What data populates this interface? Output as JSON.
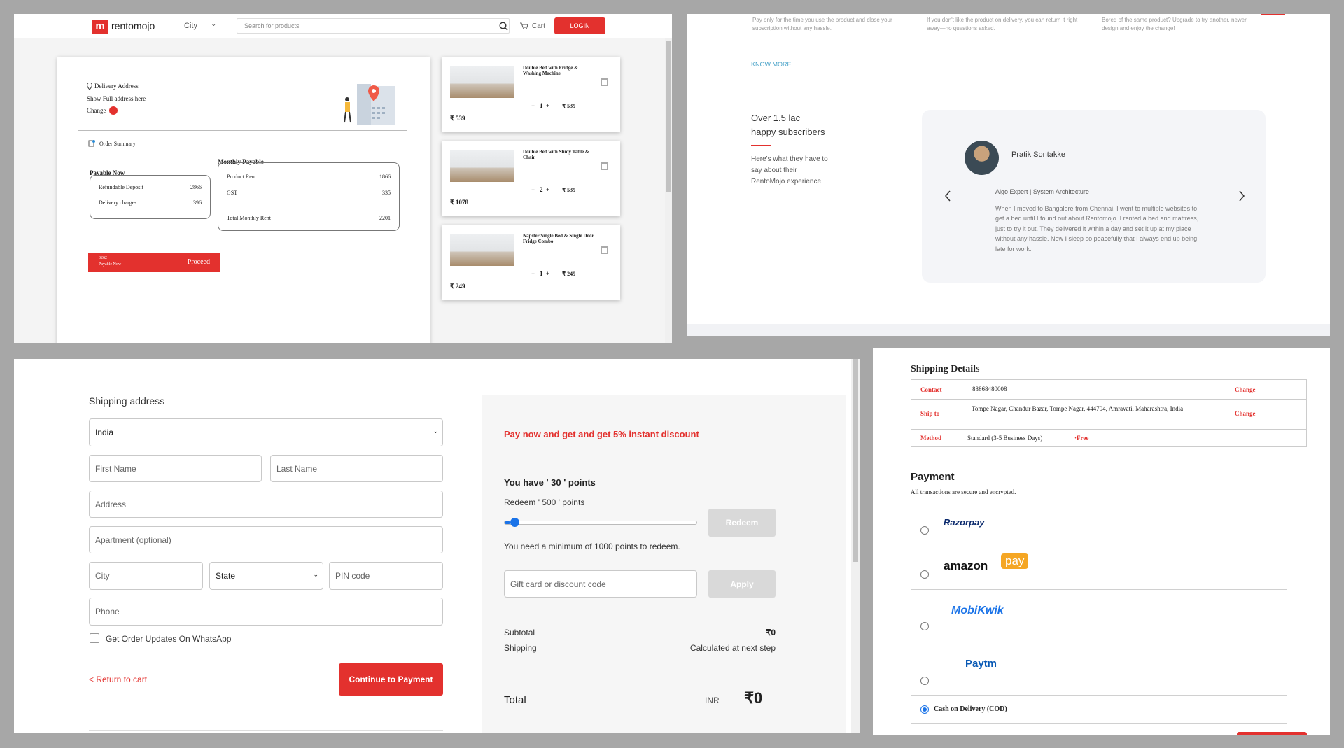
{
  "cart_page": {
    "brand": "rentomojo",
    "city_label": "City",
    "search_placeholder": "Search for products",
    "cart_label": "Cart",
    "login_label": "LOGIN",
    "delivery_title": "Delivery Address",
    "address_hint": "Show Full address here",
    "change_label": "Change",
    "order_summary_title": "Order Summary",
    "payable_now": {
      "title": "Payable Now",
      "rows": [
        {
          "label": "Refundable Deposit",
          "value": "2866"
        },
        {
          "label": "Delivery charges",
          "value": "396"
        }
      ]
    },
    "monthly_payable": {
      "title": "Monthly Payable",
      "rows": [
        {
          "label": "Product Rent",
          "value": "1866"
        },
        {
          "label": "GST",
          "value": "335"
        }
      ],
      "total_label": "Total Monthly Rent",
      "total_value": "2201"
    },
    "proceed_amount": "3262",
    "proceed_sub": "Payable Now",
    "proceed_label": "Proceed",
    "items": [
      {
        "name": "Double Bed with Fridge & Washing Machine",
        "qty": "1",
        "rent": "₹ 539",
        "total": "₹ 539"
      },
      {
        "name": "Double Bed with Study Table & Chair",
        "qty": "2",
        "rent": "₹ 539",
        "total": "₹ 1078"
      },
      {
        "name": "Napster Single Bed & Single Door Fridge Combo",
        "qty": "1",
        "rent": "₹ 249",
        "total": "₹ 249"
      }
    ],
    "qty_minus": "−",
    "qty_plus": "+"
  },
  "landing": {
    "benefits": [
      "Pay only for the time you use the product and close your subscription without any hassle.",
      "If you don't like the product on delivery, you can return it right away—no questions asked.",
      "Bored of the same product? Upgrade to try another, newer design and enjoy the change!"
    ],
    "know_more": "KNOW MORE",
    "subscribers_line1": "Over 1.5 lac",
    "subscribers_line2": "happy subscribers",
    "subscribers_desc": "Here's what they have to say about their RentoMojo experience.",
    "testimonial": {
      "name": "Pratik Sontakke",
      "role": "Algo Expert | System Architecture",
      "quote": "When I moved to Bangalore from Chennai, I went to multiple websites to get a bed until I found out about Rentomojo. I rented a bed and mattress, just to try it out. They delivered it within a day and set it up at my place without any hassle. Now I sleep so peacefully that I always end up being late for work."
    }
  },
  "checkout": {
    "title": "Shipping address",
    "country": "India",
    "placeholders": {
      "first_name": "First Name",
      "last_name": "Last Name",
      "address": "Address",
      "apartment": "Apartment (optional)",
      "city": "City",
      "state": "State",
      "pin": "PIN code",
      "phone": "Phone",
      "gift": "Gift card or discount code"
    },
    "whatsapp_label": "Get Order Updates On WhatsApp",
    "return_link": "< Return to cart",
    "continue_label": "Continue to Payment",
    "discount_banner": "Pay now and get and get 5% instant discount",
    "points_title": "You have ' 30 ' points",
    "redeem_label": "Redeem ' 500 ' points",
    "redeem_button": "Redeem",
    "points_note": "You need a minimum of 1000 points to redeem.",
    "points_progress": 0.03,
    "apply_button": "Apply",
    "subtotal_label": "Subtotal",
    "subtotal_value": "₹0",
    "shipping_label": "Shipping",
    "shipping_value": "Calculated at next step",
    "total_label": "Total",
    "currency": "INR",
    "total_value": "₹0"
  },
  "payment_page": {
    "shipping_title": "Shipping Details",
    "contact_label": "Contact",
    "contact_value": "88868480008",
    "ship_label": "Ship to",
    "ship_value": "Tompe Nagar, Chandur Bazar, Tompe Nagar, 444704, Amravati, Maharashtra, India",
    "method_label": "Method",
    "method_value": "Standard (3-5 Business Days)",
    "method_free": "·Free",
    "change_label": "Change",
    "payment_title": "Payment",
    "secure_note": "All transactions are secure and encrypted.",
    "options": {
      "razorpay": "Razorpay",
      "amazon": "amazon",
      "amazon_pay": "pay",
      "mobikwik": "MobiKwik",
      "paytm": "Paytm",
      "cod": "Cash on Delivery (COD)"
    },
    "colors": {
      "razorpay": "#0b2a6d",
      "amazon_pay": "#f5a623",
      "mobikwik": "#1a73e8",
      "paytm": "#0a5ab5"
    }
  }
}
